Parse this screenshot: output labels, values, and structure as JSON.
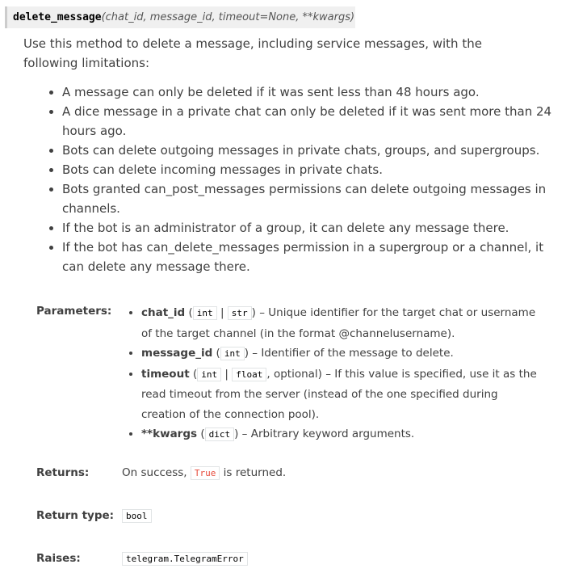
{
  "signature": {
    "name": "delete_message",
    "args": "(chat_id, message_id, timeout=None, **kwargs)"
  },
  "description": "Use this method to delete a message, including service messages, with the following limitations:",
  "limitations": [
    "A message can only be deleted if it was sent less than 48 hours ago.",
    "A dice message in a private chat can only be deleted if it was sent more than 24 hours ago.",
    "Bots can delete outgoing messages in private chats, groups, and supergroups.",
    "Bots can delete incoming messages in private chats.",
    "Bots granted can_post_messages permissions can delete outgoing messages in channels.",
    "If the bot is an administrator of a group, it can delete any message there.",
    "If the bot has can_delete_messages permission in a supergroup or a channel, it can delete any message there."
  ],
  "parameters": {
    "label": "Parameters:",
    "items": [
      {
        "name": "chat_id",
        "open": " (",
        "type1": "int",
        "sep": " | ",
        "type2": "str",
        "close": ")",
        "desc": " – Unique identifier for the target chat or username of the target channel (in the format @channelusername)."
      },
      {
        "name": "message_id",
        "open": " (",
        "type1": "int",
        "close": ")",
        "desc": " – Identifier of the message to delete."
      },
      {
        "name": "timeout",
        "open": " (",
        "type1": "int",
        "sep": " | ",
        "type2": "float",
        "close": ", optional)",
        "desc": " – If this value is specified, use it as the read timeout from the server (instead of the one specified during creation of the connection pool)."
      },
      {
        "name": "**kwargs",
        "open": " (",
        "type1": "dict",
        "close": ")",
        "desc": " – Arbitrary keyword arguments."
      }
    ]
  },
  "returns": {
    "label": "Returns:",
    "prefix": "On success, ",
    "code": "True",
    "suffix": " is returned."
  },
  "return_type": {
    "label": "Return type:",
    "code": "bool"
  },
  "raises": {
    "label": "Raises:",
    "code": "telegram.TelegramError"
  }
}
